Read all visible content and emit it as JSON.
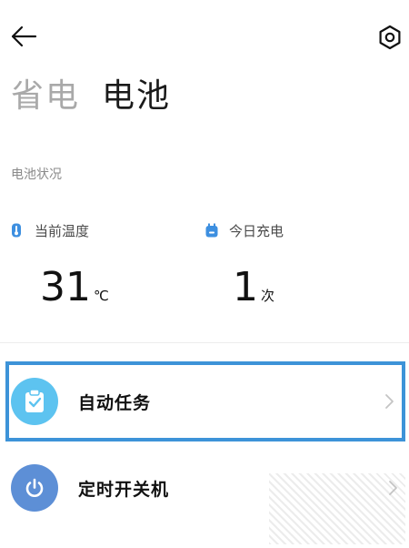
{
  "header": {
    "tabs": [
      {
        "label": "省电",
        "active": false
      },
      {
        "label": "电池",
        "active": true
      }
    ]
  },
  "battery_status": {
    "section_label": "电池状况",
    "stats": [
      {
        "label": "当前温度",
        "value": "31",
        "unit": "℃",
        "icon": "thermometer-icon"
      },
      {
        "label": "今日充电",
        "value": "1",
        "unit": "次",
        "icon": "battery-charge-icon"
      }
    ]
  },
  "list": {
    "items": [
      {
        "label": "自动任务",
        "icon": "clipboard-check-icon",
        "highlighted": true
      },
      {
        "label": "定时开关机",
        "icon": "power-icon",
        "highlighted": false
      }
    ]
  },
  "colors": {
    "accent_blue": "#3d93d8",
    "light_blue": "#5dc3f0",
    "medium_blue": "#5d8fd6",
    "inactive_tab": "#a9a9a9",
    "secondary_text": "#8a8a8a"
  }
}
